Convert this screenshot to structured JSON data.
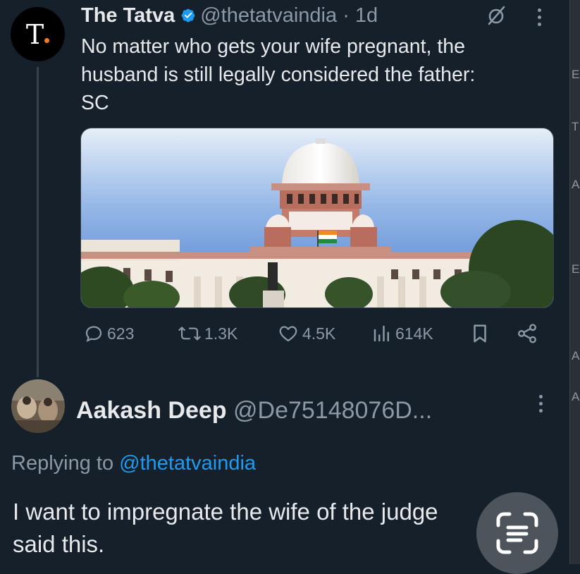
{
  "tweet": {
    "author_name": "The Tatva",
    "handle": "@thetatvaindia",
    "time": "· 1d",
    "avatar_letter": "T.",
    "text": "No matter who gets your wife pregnant, the\nhusband is still legally considered the father:\nSC",
    "media_alt": "Supreme Court of India building with Indian flag",
    "stats": {
      "replies": "623",
      "reposts": "1.3K",
      "likes": "4.5K",
      "views": "614K"
    }
  },
  "reply": {
    "author_name": "Aakash Deep",
    "handle": "@De75148076D...",
    "replying_prefix": "Replying to",
    "replying_to": "@thetatvaindia",
    "text": "I want to impregnate the wife of the judge\nsaid this."
  },
  "icons": {
    "verified": "verified-badge-icon",
    "mute": "mute-icon",
    "more": "more-vertical-icon",
    "reply": "reply-icon",
    "repost": "repost-icon",
    "like": "heart-icon",
    "views": "views-chart-icon",
    "bookmark": "bookmark-icon",
    "share": "share-icon",
    "lens": "google-lens-icon"
  },
  "colors": {
    "background": "#15202b",
    "text": "#e7e9ea",
    "secondary": "#8b98a5",
    "accent": "#1d9bf0",
    "logo_dot": "#f47a20"
  }
}
